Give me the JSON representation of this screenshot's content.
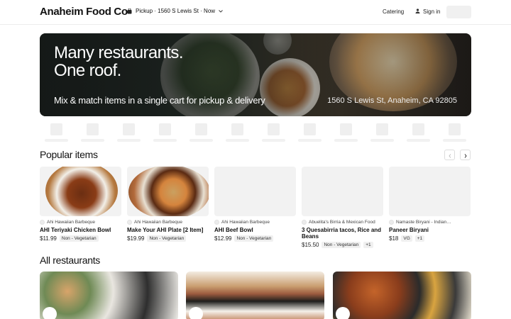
{
  "header": {
    "brand": "Anaheim Food Co",
    "pickup_label": "Pickup · 1560 S Lewis St · Now",
    "catering": "Catering",
    "sign_in": "Sign in"
  },
  "hero": {
    "line1": "Many restaurants.",
    "line2": "One roof.",
    "subtitle": "Mix & match items in a single cart for pickup & delivery",
    "address": "1560 S Lewis St, Anaheim, CA 92805"
  },
  "popular": {
    "title": "Popular items",
    "items": [
      {
        "restaurant": "Ahi Hawaiian Barbeque",
        "name": "AHI Teriyaki Chicken Bowl",
        "price": "$11.99",
        "tags": [
          "Non - Vegetarian"
        ]
      },
      {
        "restaurant": "Ahi Hawaiian Barbeque",
        "name": "Make Your AHI Plate [2 Item]",
        "price": "$19.99",
        "tags": [
          "Non - Vegetarian"
        ]
      },
      {
        "restaurant": "Ahi Hawaiian Barbeque",
        "name": "AHI Beef Bowl",
        "price": "$12.99",
        "tags": [
          "Non - Vegetarian"
        ]
      },
      {
        "restaurant": "Abuelita's Birria & Mexican Food",
        "name": "3 Quesabirria tacos, Rice and Beans",
        "price": "$15.50",
        "tags": [
          "Non - Vegetarian",
          "+1"
        ]
      },
      {
        "restaurant": "Namaste Biryani - Indian…",
        "name": "Paneer Biryani",
        "price": "$18",
        "tags": [
          "VG",
          "+1"
        ]
      }
    ]
  },
  "restaurants": {
    "title": "All restaurants"
  },
  "icons": {
    "pickup": "bag-icon",
    "chevron": "chevron-down-icon",
    "user": "user-icon",
    "prev": "chevron-left-icon",
    "next": "chevron-right-icon"
  }
}
